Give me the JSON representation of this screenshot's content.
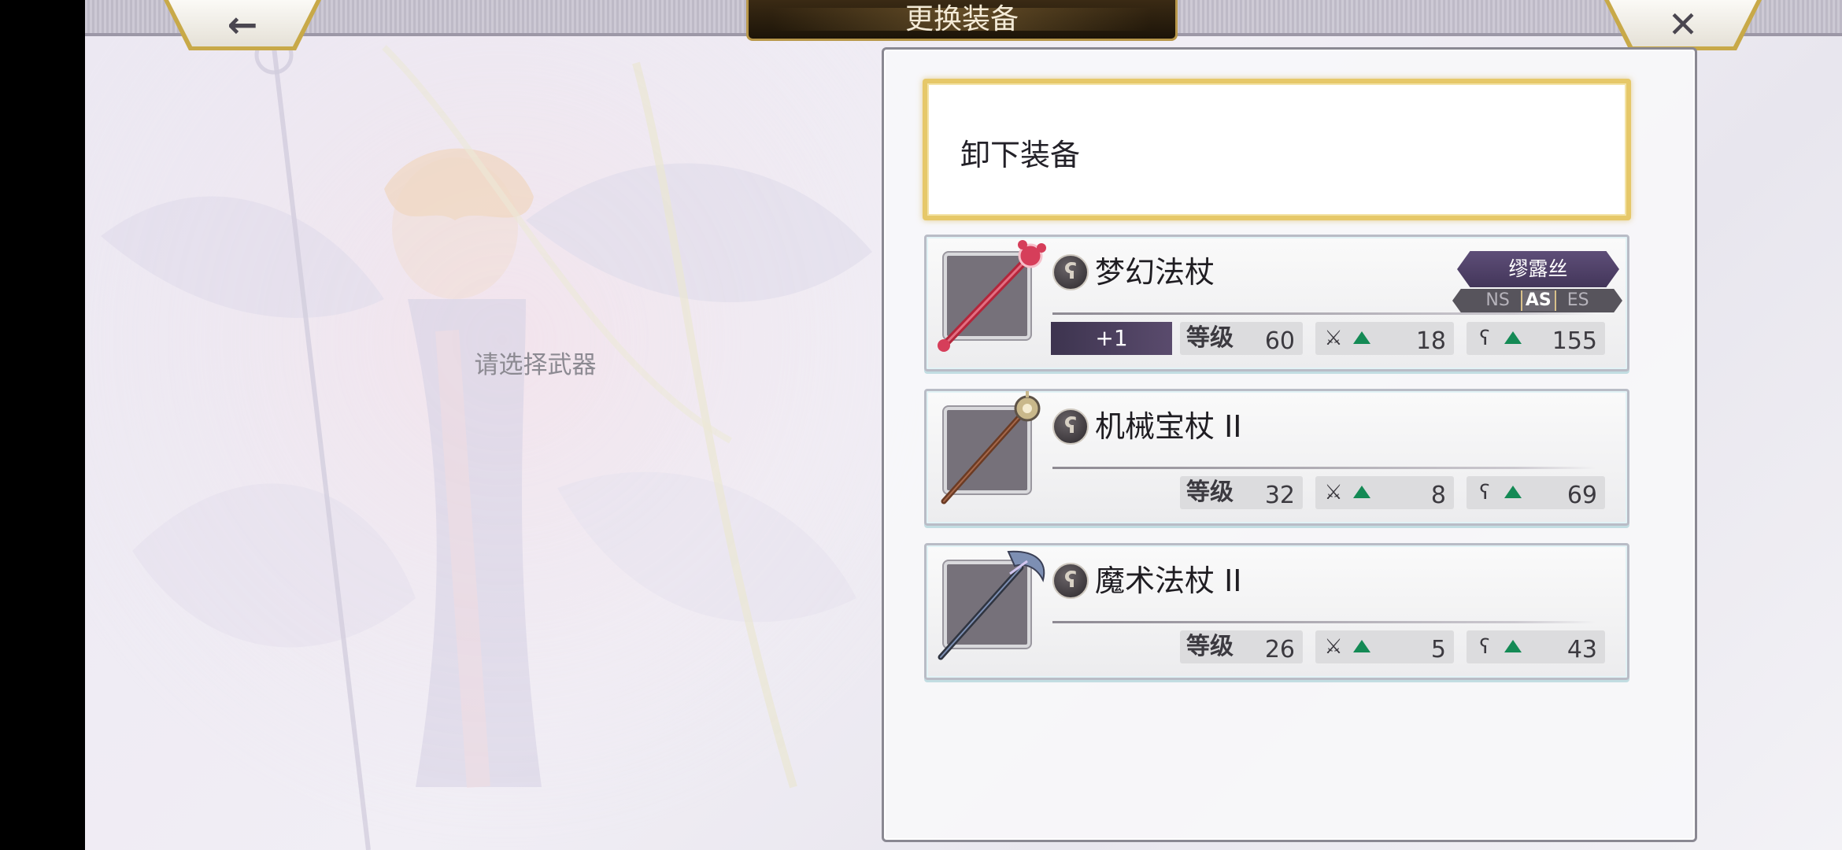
{
  "header": {
    "title": "更换装备",
    "back_icon": "←",
    "close_icon": "✕"
  },
  "left_area": {
    "hint": "请选择武器"
  },
  "unequip": {
    "label": "卸下装备"
  },
  "weapons": [
    {
      "name": "梦幻法杖",
      "plus": "+1",
      "level_label": "等级",
      "level": "60",
      "atk": "18",
      "mag": "155",
      "owner": "缪露丝",
      "tags": [
        "NS",
        "AS",
        "ES"
      ],
      "active_tag": "AS",
      "colors": {
        "shaft": "#b3263b",
        "head": "#d63e5a"
      }
    },
    {
      "name": "机械宝杖 II",
      "level_label": "等级",
      "level": "32",
      "atk": "8",
      "mag": "69",
      "colors": {
        "shaft": "#6b3b24",
        "head": "#c9b88b"
      }
    },
    {
      "name": "魔术法杖 II",
      "level_label": "等级",
      "level": "26",
      "atk": "5",
      "mag": "43",
      "colors": {
        "shaft": "#2f3440",
        "head": "#7d8fb3"
      }
    }
  ],
  "colors": {
    "stat_up": "#148a55",
    "selected_border": "#e6c869",
    "owner_badge": "#4f416a"
  }
}
